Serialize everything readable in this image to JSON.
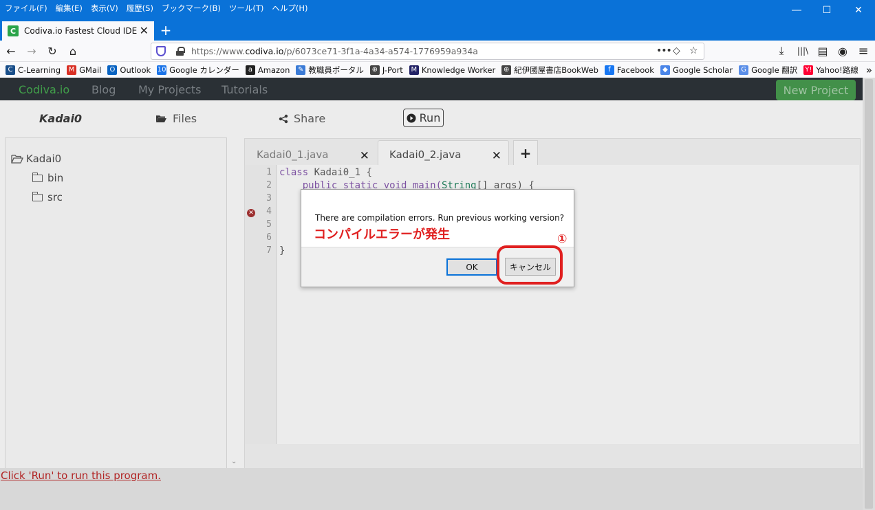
{
  "menubar": {
    "items": [
      "ファイル(F)",
      "編集(E)",
      "表示(V)",
      "履歴(S)",
      "ブックマーク(B)",
      "ツール(T)",
      "ヘルプ(H)"
    ],
    "minimize_icon": "―",
    "maximize_icon": "☐",
    "close_icon": "✕"
  },
  "tab": {
    "title": "Codiva.io Fastest Cloud IDE",
    "favicon_letter": "C",
    "close_icon": "✕",
    "new_tab_icon": "+"
  },
  "nav": {
    "back_icon": "←",
    "forward_icon": "→",
    "reload_icon": "↻",
    "home_icon": "⌂",
    "url_prefix": "https://www.",
    "url_domain": "codiva.io",
    "url_path": "/p/6073ce71-3f1a-4a34-a574-1776959a934a",
    "more_icon": "•••",
    "pocket_icon": "◇",
    "star_icon": "☆",
    "download_icon": "⤓",
    "library_icon": "|||\\",
    "sidebar_icon": "▤",
    "account_icon": "◉",
    "menu_icon": "≡"
  },
  "bookmarks": [
    {
      "label": "C-Learning",
      "icon": "C",
      "color": "#1a4f8a"
    },
    {
      "label": "GMail",
      "icon": "M",
      "color": "#d93025"
    },
    {
      "label": "Outlook",
      "icon": "O",
      "color": "#0a64c2"
    },
    {
      "label": "Google カレンダー",
      "icon": "10",
      "color": "#1a73e8"
    },
    {
      "label": "Amazon",
      "icon": "a",
      "color": "#222222"
    },
    {
      "label": "教職員ポータル",
      "icon": "✎",
      "color": "#3b7bd6"
    },
    {
      "label": "J-Port",
      "icon": "⊕",
      "color": "#444444"
    },
    {
      "label": "Knowledge Worker",
      "icon": "M",
      "color": "#222266"
    },
    {
      "label": "紀伊國屋書店BookWeb",
      "icon": "⊕",
      "color": "#444444"
    },
    {
      "label": "Facebook",
      "icon": "f",
      "color": "#1877f2"
    },
    {
      "label": "Google Scholar",
      "icon": "◆",
      "color": "#4a85e8"
    },
    {
      "label": "Google 翻訳",
      "icon": "G",
      "color": "#5a8ee8"
    },
    {
      "label": "Yahoo!路線",
      "icon": "Y!",
      "color": "#ff0033"
    }
  ],
  "bookmarks_more_icon": "»",
  "app": {
    "brand": "Codiva.io",
    "nav": [
      "Blog",
      "My Projects",
      "Tutorials"
    ],
    "new_project": "New Project",
    "project_name": "Kadai0",
    "files_label": "Files",
    "share_label": "Share",
    "run_label": "Run",
    "tree": {
      "root": "Kadai0",
      "children": [
        "bin",
        "src"
      ]
    },
    "tabs": [
      {
        "name": "Kadai0_1.java",
        "close": "✕"
      },
      {
        "name": "Kadai0_2.java",
        "close": "✕"
      }
    ],
    "add_tab": "+",
    "line_numbers": [
      "1",
      "2",
      "3",
      "4",
      "5",
      "6",
      "7"
    ],
    "error_line": "4",
    "code": {
      "line1_kw": "class",
      "line1_name": " Kadai0_1 {",
      "line2_a": "    public static void main(",
      "line2_type": "String",
      "line2_b": "[] args) {",
      "line7": "}"
    },
    "status": "Click 'Run' to run this program."
  },
  "dialog": {
    "message": "There are compilation errors. Run previous working version?",
    "annotation": "コンパイルエラーが発生",
    "ok": "OK",
    "cancel": "キャンセル",
    "callout": "①"
  },
  "colors": {
    "browser_chrome": "#0a72d8",
    "app_nav": "#262c31",
    "brand": "#3e9e47",
    "new_project": "#3f8e46",
    "annotation": "#e02020"
  }
}
